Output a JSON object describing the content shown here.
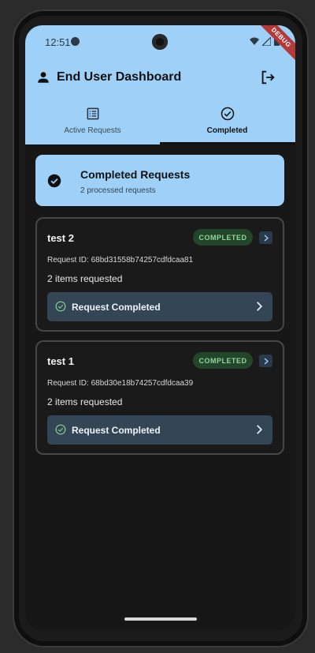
{
  "status_bar": {
    "time": "12:51",
    "debug_label": "DEBUG"
  },
  "app_bar": {
    "title": "End User Dashboard"
  },
  "tabs": [
    {
      "label": "Active Requests",
      "icon": "list-alt-icon",
      "active": false
    },
    {
      "label": "Completed",
      "icon": "check-circle-icon",
      "active": true
    }
  ],
  "summary": {
    "title": "Completed Requests",
    "subtitle": "2 processed requests"
  },
  "requests": [
    {
      "name": "test 2",
      "status": "COMPLETED",
      "request_id": "Request ID: 68bd31558b74257cdfdcaa81",
      "items": "2 items requested",
      "action_label": "Request Completed"
    },
    {
      "name": "test 1",
      "status": "COMPLETED",
      "request_id": "Request ID: 68bd30e18b74257cdfdcaa39",
      "items": "2 items requested",
      "action_label": "Request Completed"
    }
  ],
  "colors": {
    "header_bg": "#9ed0f8",
    "screen_bg": "#171717",
    "badge_bg": "#23452a",
    "badge_text": "#8fd69a",
    "action_bg": "#344556"
  }
}
